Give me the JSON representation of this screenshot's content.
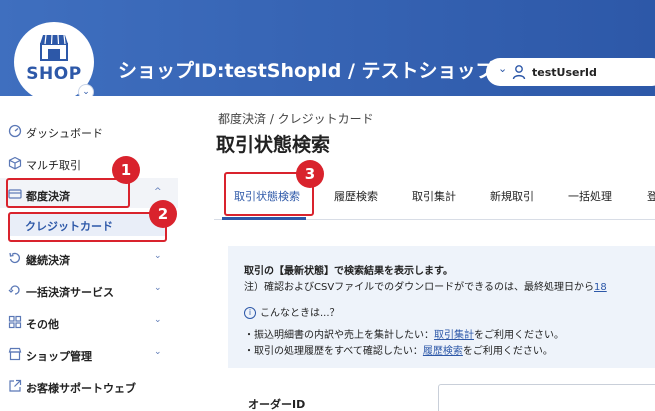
{
  "header": {
    "logo_text": "SHOP",
    "shop_title": "ショップID:testShopId / テストショップ",
    "user_name": "testUserId",
    "logo_chevron": "⌄",
    "user_chevron": "⌄"
  },
  "sidebar": {
    "items": [
      {
        "label": "ダッシュボード",
        "icon": "dashboard-icon"
      },
      {
        "label": "マルチ取引",
        "icon": "cube-icon"
      },
      {
        "label": "都度決済",
        "icon": "card-icon",
        "caret": "^"
      },
      {
        "label": "継続決済",
        "icon": "repeat-icon",
        "caret": "⌄"
      },
      {
        "label": "一括決済サービス",
        "icon": "batch-icon",
        "caret": "⌄"
      },
      {
        "label": "その他",
        "icon": "grid-icon",
        "caret": "⌄"
      },
      {
        "label": "ショップ管理",
        "icon": "shop-icon",
        "caret": "⌄"
      },
      {
        "label": "お客様サポートウェブ",
        "icon": "external-link-icon"
      }
    ],
    "sub_item": "クレジットカード"
  },
  "main": {
    "breadcrumb": "都度決済 / クレジットカード",
    "title": "取引状態検索",
    "tabs": [
      "取引状態検索",
      "履歴検索",
      "取引集計",
      "新規取引",
      "一括処理",
      "登"
    ],
    "info": {
      "line1": "取引の【最新状態】で検索結果を表示します。",
      "line2": "注）確認およびCSVファイルでのダウンロードができるのは、最終処理日から",
      "line2_link": "18",
      "help_title": "こんなときは...？",
      "bullet1_prefix": "・振込明細書の内訳や売上を集計したい：",
      "bullet1_link": "取引集計",
      "bullet1_suffix": "をご利用ください。",
      "bullet2_prefix": "・取引の処理履歴をすべて確認したい：",
      "bullet2_link": "履歴検索",
      "bullet2_suffix": "をご利用ください。"
    },
    "order_id_label": "オーダーID"
  },
  "callouts": [
    "1",
    "2",
    "3"
  ],
  "colors": {
    "header": "#2d58a8",
    "accent": "#2d58a8",
    "callout": "#d9232d",
    "info_bg": "#eef3fa"
  }
}
